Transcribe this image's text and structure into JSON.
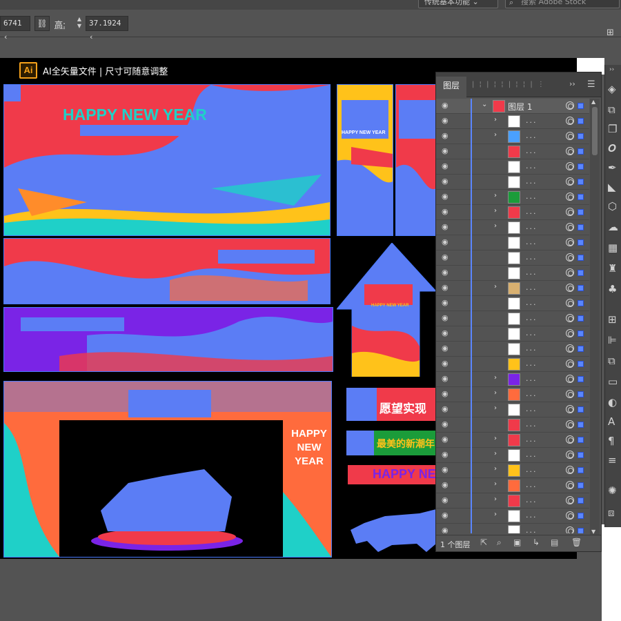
{
  "control_bar": {
    "width_value": "6741 ‹",
    "height_label": "高:",
    "height_value": "37.1924 ‹"
  },
  "workspace": {
    "label": "传统基本功能 ⌄",
    "search_placeholder": "搜索 Adobe Stock"
  },
  "artboard": {
    "ai_badge": "Ai",
    "caption": "AI全矢量文件  |  尺寸可随意调整",
    "headline": "HAPPY NEW YEAR",
    "arch_text": "HAPPY NEW YEAR",
    "banner_text_1": "愿望实现",
    "banner_text_2": "最美的新潮年",
    "banner_text_3": "HAPPY NEW",
    "vertical_text": "HAPPY NEW YEAR",
    "arrow_text": "HAPPY NEW YEAR"
  },
  "layers_panel": {
    "tab_label": "图层",
    "top_layer_name": "图层 1",
    "row_placeholder": "...",
    "row_count": 29,
    "footer_count": "1 个图层"
  },
  "colors": {
    "selection_blue": "#5a86ff",
    "art_red": "#f03a4a",
    "art_purple": "#7a24e6",
    "art_blue": "#5b7df5"
  },
  "icons": {
    "visibility": "eye-icon",
    "expand": "chevron-right-icon",
    "target": "target-icon",
    "link": "link-icon"
  }
}
